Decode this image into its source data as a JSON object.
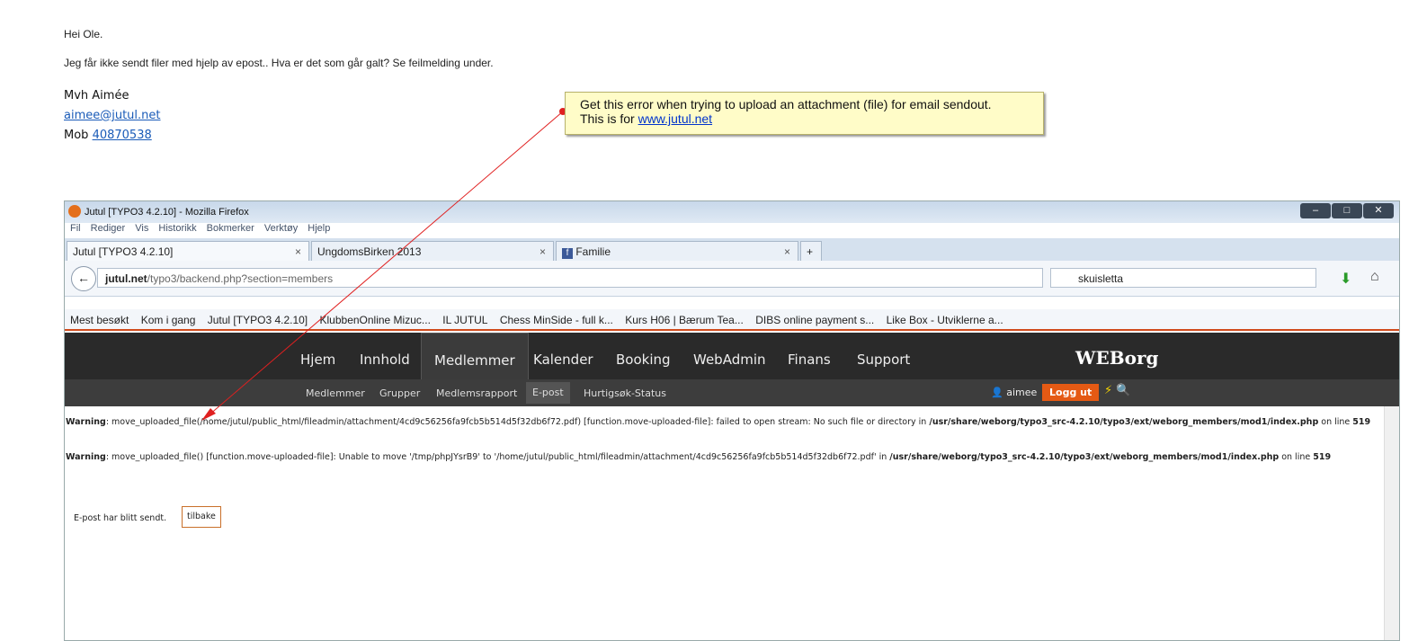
{
  "email": {
    "greeting": "Hei Ole.",
    "message": "Jeg får ikke sendt filer med hjelp av epost.. Hva er det som går galt? Se feilmelding under.",
    "signature": "Mvh Aimée",
    "email_link": "aimee@jutul.net",
    "mob_label": "Mob ",
    "mob_number": "40870538"
  },
  "note": {
    "line1": "Get this error when trying to upload an attachment (file) for email sendout.",
    "line2_prefix": "This is for ",
    "line2_link": "www.jutul.net"
  },
  "browser": {
    "title": "Jutul [TYPO3 4.2.10] - Mozilla Firefox",
    "menu": [
      "Fil",
      "Rediger",
      "Vis",
      "Historikk",
      "Bokmerker",
      "Verktøy",
      "Hjelp"
    ],
    "tabs": [
      "Jutul [TYPO3 4.2.10]",
      "UngdomsBirken 2013",
      "Familie"
    ],
    "new_tab": "+",
    "url_domain": "jutul.net",
    "url_path": "/typo3/backend.php?section=members",
    "search_value": "skuisletta",
    "bookmarks": [
      "Mest besøkt",
      "Kom i gang",
      "Jutul [TYPO3 4.2.10]",
      "KlubbenOnline  Mizuc...",
      "IL JUTUL",
      "Chess MinSide - full k...",
      "Kurs H06 | Bærum Tea...",
      "DIBS online payment s...",
      "Like Box - Utviklerne a..."
    ]
  },
  "weborg": {
    "logo": "WEBorg",
    "nav": [
      "Hjem",
      "Innhold",
      "Medlemmer",
      "Kalender",
      "Booking",
      "WebAdmin",
      "Finans",
      "Support"
    ],
    "subnav": [
      "Medlemmer",
      "Grupper",
      "Medlemsrapport",
      "E-post",
      "Hurtigsøk-Status"
    ],
    "user": "aimee",
    "logout": "Logg ut"
  },
  "content": {
    "warn1_label": "Warning",
    "warn1_a": ": move_uploaded_file(/home/jutul/public_html/fileadmin/attachment/4cd9c56256fa9fcb5b514d5f32db6f72.pdf) [function.move-uploaded-file]: failed to open stream: No such file or directory in ",
    "warn1_path": "/usr/share/weborg/typo3_src-4.2.10/typo3/ext/weborg_members/mod1/index.php",
    "warn1_on": " on line ",
    "warn1_line": "519",
    "warn2_label": "Warning",
    "warn2_a": ": move_uploaded_file() [function.move-uploaded-file]: Unable to move '/tmp/phpJYsrB9' to '/home/jutul/public_html/fileadmin/attachment/4cd9c56256fa9fcb5b514d5f32db6f72.pdf' in ",
    "warn2_path": "/usr/share/weborg/typo3_src-4.2.10/typo3/ext/weborg_members/mod1/index.php",
    "warn2_on": " on line ",
    "warn2_line": "519",
    "sent": "E-post har blitt sendt.",
    "back": "tilbake"
  }
}
